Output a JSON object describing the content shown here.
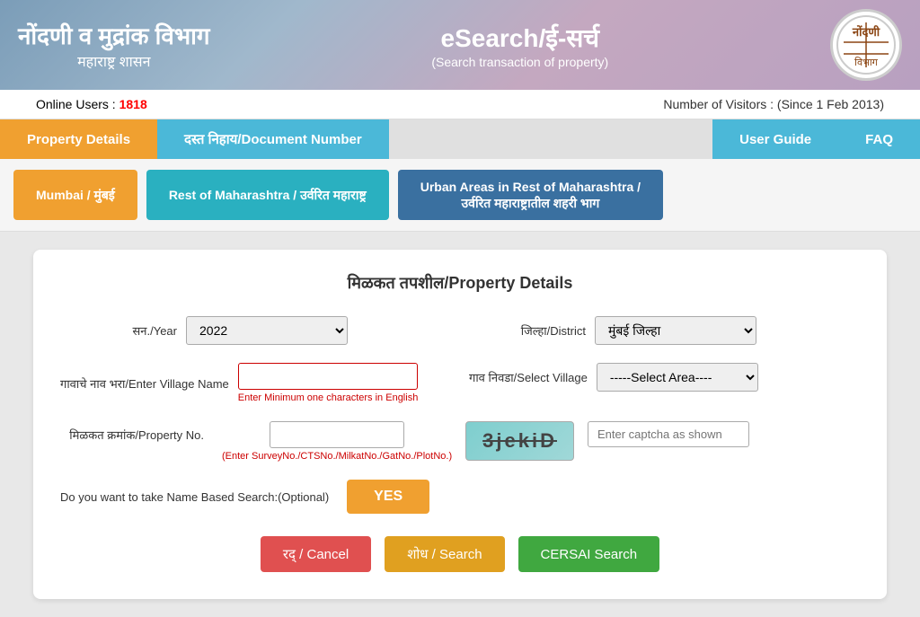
{
  "header": {
    "title_marathi": "नोंदणी व मुद्रांक विभाग",
    "subtitle_marathi": "महाराष्ट्र शासन",
    "esearch_title": "eSearch/ई-सर्च",
    "esearch_subtitle": "(Search transaction of property)"
  },
  "info_bar": {
    "online_label": "Online Users :",
    "online_count": "1818",
    "visitors_label": "Number of Visitors : (Since 1 Feb 2013)"
  },
  "nav_tabs": {
    "property_details": "Property Details",
    "document_number": "दस्त निहाय/Document Number",
    "user_guide": "User Guide",
    "faq": "FAQ"
  },
  "regions": {
    "mumbai": "Mumbai / मुंबई",
    "rest_maharashtra": "Rest of Maharashtra / उर्वरित महाराष्ट्र",
    "urban_areas": "Urban Areas in Rest of Maharashtra /\nउर्वरित महाराष्ट्रातील शहरी भाग"
  },
  "form": {
    "title": "मिळकत तपशील/Property Details",
    "year_label": "सन./Year",
    "year_value": "2022",
    "district_label": "जिल्हा/District",
    "district_value": "मुंबई जिल्हा",
    "village_name_label": "गावाचे नाव भरा/Enter Village Name",
    "village_name_placeholder": "",
    "village_error": "Enter Minimum one characters in English",
    "select_village_label": "गाव निवडा/Select Village",
    "select_village_placeholder": "-----Select Area----",
    "property_no_label": "मिळकत क्रमांक/Property No.",
    "property_hint": "(Enter SurveyNo./CTSNo./MilkatNo./GatNo./PlotNo.)",
    "captcha_text": "3jekiD",
    "captcha_placeholder": "Enter captcha as shown",
    "name_search_label": "Do you want to take Name Based Search:(Optional)",
    "yes_btn": "YES",
    "cancel_btn": "रद् / Cancel",
    "search_btn": "शोध / Search",
    "cersai_btn": "CERSAI Search"
  }
}
